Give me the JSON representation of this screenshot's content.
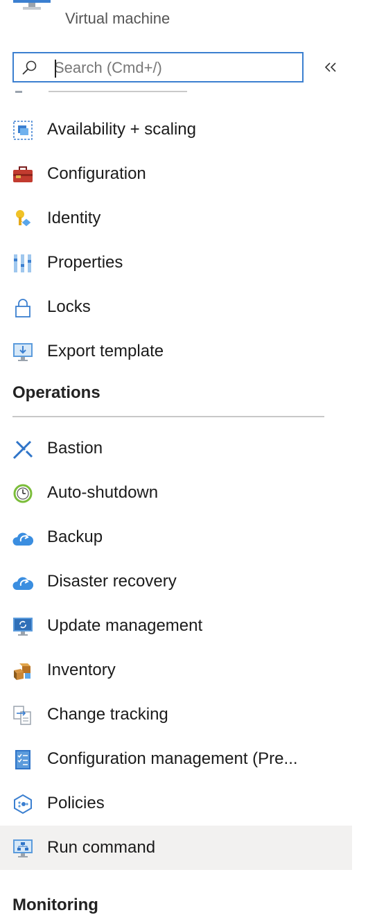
{
  "header": {
    "subtitle": "Virtual machine"
  },
  "search": {
    "placeholder": "Search (Cmd+/)",
    "icon": "search-icon",
    "collapse_icon": "double-chevron-left-icon"
  },
  "menu": {
    "items_top": [
      {
        "label": "Availability + scaling",
        "icon": "availability-scaling-icon"
      },
      {
        "label": "Configuration",
        "icon": "toolbox-icon"
      },
      {
        "label": "Identity",
        "icon": "key-identity-icon"
      },
      {
        "label": "Properties",
        "icon": "properties-bars-icon"
      },
      {
        "label": "Locks",
        "icon": "lock-icon"
      },
      {
        "label": "Export template",
        "icon": "export-template-icon"
      }
    ],
    "operations": {
      "title": "Operations",
      "items": [
        {
          "label": "Bastion",
          "icon": "bastion-icon"
        },
        {
          "label": "Auto-shutdown",
          "icon": "clock-icon"
        },
        {
          "label": "Backup",
          "icon": "cloud-backup-icon"
        },
        {
          "label": "Disaster recovery",
          "icon": "cloud-recovery-icon"
        },
        {
          "label": "Update management",
          "icon": "monitor-update-icon"
        },
        {
          "label": "Inventory",
          "icon": "boxes-icon"
        },
        {
          "label": "Change tracking",
          "icon": "documents-icon"
        },
        {
          "label": "Configuration management (Pre...",
          "icon": "checklist-icon"
        },
        {
          "label": "Policies",
          "icon": "policy-icon"
        },
        {
          "label": "Run command",
          "icon": "monitor-run-icon"
        }
      ]
    },
    "monitoring_title": "Monitoring"
  },
  "colors": {
    "accent": "#3b7fd0",
    "selected_background": "#f2f1f0",
    "divider": "#c8c8c8"
  }
}
